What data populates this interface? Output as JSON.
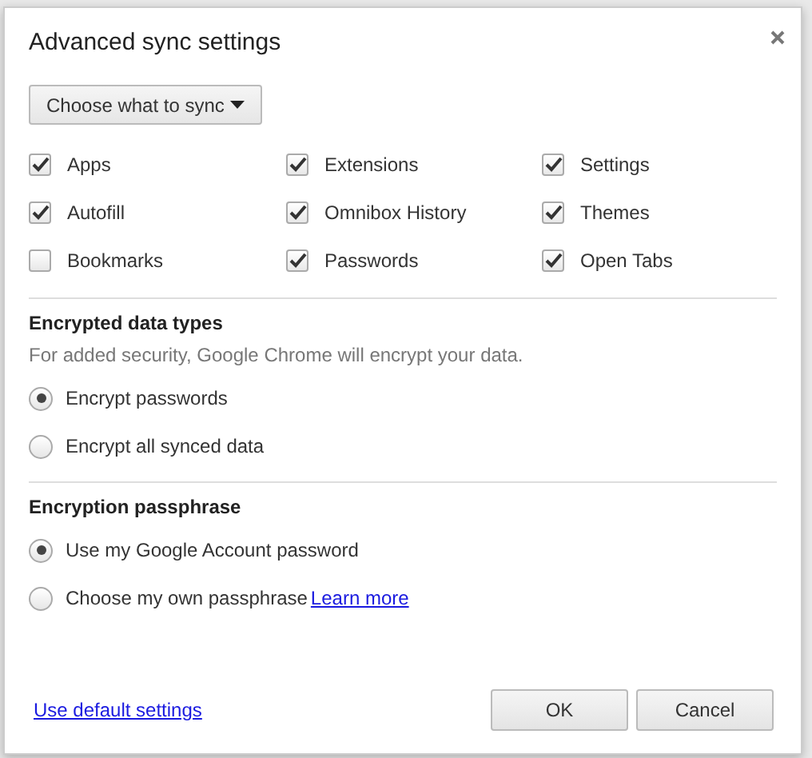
{
  "dialog": {
    "title": "Advanced sync settings"
  },
  "sync_dropdown": {
    "label": "Choose what to sync"
  },
  "data_types": [
    {
      "label": "Apps",
      "checked": true
    },
    {
      "label": "Extensions",
      "checked": true
    },
    {
      "label": "Settings",
      "checked": true
    },
    {
      "label": "Autofill",
      "checked": true
    },
    {
      "label": "Omnibox History",
      "checked": true
    },
    {
      "label": "Themes",
      "checked": true
    },
    {
      "label": "Bookmarks",
      "checked": false
    },
    {
      "label": "Passwords",
      "checked": true
    },
    {
      "label": "Open Tabs",
      "checked": true
    }
  ],
  "sections": [
    {
      "heading": "Encrypted data types",
      "description": "For added security, Google Chrome will encrypt your data.",
      "options": [
        {
          "label": "Encrypt passwords",
          "selected": true
        },
        {
          "label": "Encrypt all synced data",
          "selected": false
        }
      ]
    },
    {
      "heading": "Encryption passphrase",
      "options": [
        {
          "label": "Use my Google Account password",
          "selected": true
        },
        {
          "label": "Choose my own passphrase",
          "link": "Learn more",
          "selected": false
        }
      ]
    }
  ],
  "footer": {
    "link": "Use default settings",
    "buttons": [
      "OK",
      "Cancel"
    ]
  }
}
